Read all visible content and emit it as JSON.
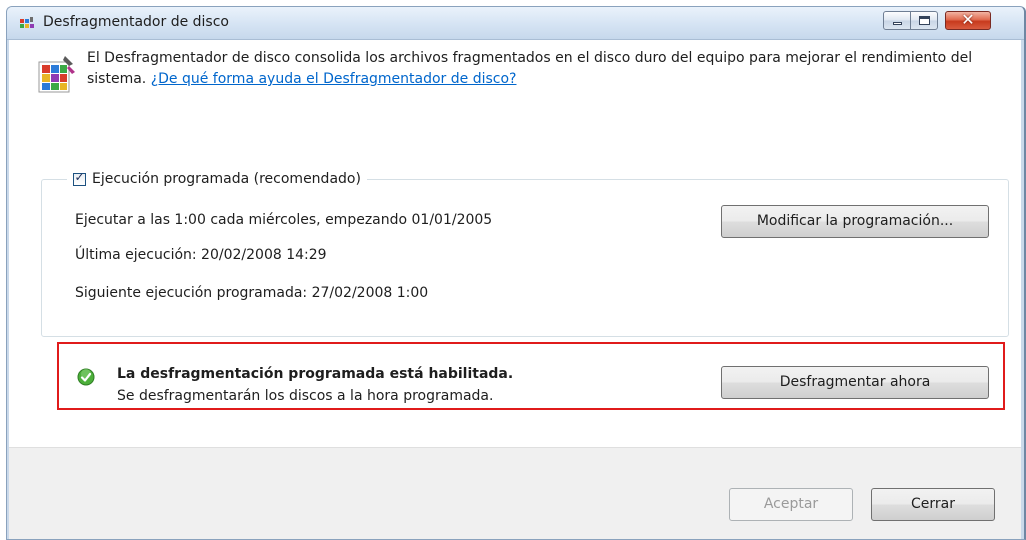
{
  "window": {
    "title": "Desfragmentador de disco"
  },
  "intro": {
    "text": "El Desfragmentador de disco consolida los archivos fragmentados en el disco duro del equipo para mejorar el rendimiento del sistema. ",
    "link": "¿De qué forma ayuda el Desfragmentador de disco?"
  },
  "schedule": {
    "checkbox_label": "Ejecución programada (recomendado)",
    "checked": true,
    "run_at": "Ejecutar a las 1:00 cada miércoles, empezando 01/01/2005",
    "last_run": "Última ejecución: 20/02/2008 14:29",
    "next_run": "Siguiente ejecución programada: 27/02/2008 1:00",
    "modify_button": "Modificar la programación..."
  },
  "status": {
    "title": "La desfragmentación programada está habilitada.",
    "subtitle": "Se desfragmentarán los discos a la hora programada.",
    "defrag_button": "Desfragmentar ahora",
    "icon": "green-check-icon"
  },
  "footer": {
    "accept_button": "Aceptar",
    "close_button": "Cerrar"
  },
  "colors": {
    "link": "#0066cc",
    "highlight_border": "#e01b1b",
    "footer_bg": "#f0f0f0",
    "status_ok": "#4caf3a"
  }
}
